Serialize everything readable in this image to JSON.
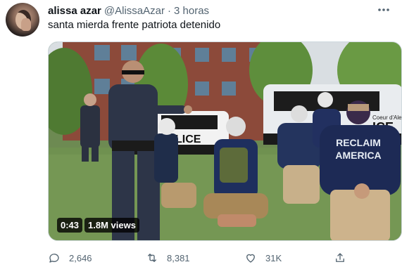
{
  "tweet": {
    "author": {
      "display_name": "alissa azar",
      "handle": "@AlissaAzar",
      "separator": "·",
      "timestamp": "3 horas"
    },
    "text": "santa mierda frente patriota detenido",
    "more_icon": "more-horizontal-icon"
  },
  "media": {
    "type": "video",
    "duration": "0:43",
    "views": "1.8M views",
    "scene_text": {
      "police_car_left": "LICE",
      "police_car_right_top": "Coeur d'Ale",
      "police_car_right": "ICE",
      "shirt_line1": "RECLAIM",
      "shirt_line2": "AMERICA"
    }
  },
  "actions": {
    "reply": {
      "icon": "reply-icon",
      "count": "2,646"
    },
    "retweet": {
      "icon": "retweet-icon",
      "count": "8,381"
    },
    "like": {
      "icon": "heart-icon",
      "count": "31K"
    },
    "share": {
      "icon": "share-icon"
    }
  },
  "colors": {
    "text_primary": "#0f1419",
    "text_secondary": "#536471",
    "border": "#cfd9de"
  }
}
